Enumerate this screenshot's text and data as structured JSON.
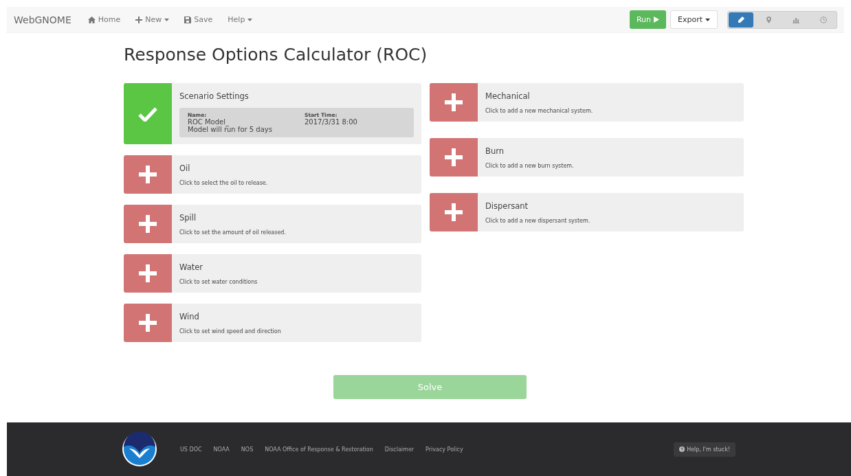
{
  "navbar": {
    "brand": "WebGNOME",
    "items": [
      {
        "label": "Home",
        "dropdown": false
      },
      {
        "label": "New",
        "dropdown": true
      },
      {
        "label": "Save",
        "dropdown": false
      },
      {
        "label": "Help",
        "dropdown": true
      }
    ],
    "run_button": "Run",
    "export_button": "Export",
    "views": [
      {
        "selected": true
      },
      {
        "selected": false
      },
      {
        "selected": false
      },
      {
        "selected": false
      }
    ]
  },
  "title": "Response Options Calculator (ROC)",
  "left_cards": [
    {
      "title": "Scenario Settings",
      "complete": true,
      "details": {
        "name_label": "Name:",
        "name": "ROC Model_",
        "duration": "Model will run for 5 days",
        "start_label": "Start Time:",
        "start": "2017/3/31 8:00"
      }
    },
    {
      "title": "Oil",
      "complete": false,
      "description": "Click to select the oil to release."
    },
    {
      "title": "Spill",
      "complete": false,
      "description": "Click to set the amount of oil released."
    },
    {
      "title": "Water",
      "complete": false,
      "description": "Click to set water conditions"
    },
    {
      "title": "Wind",
      "complete": false,
      "description": "Click to set wind speed and direction"
    }
  ],
  "right_cards": [
    {
      "title": "Mechanical",
      "complete": false,
      "description": "Click to add a new mechanical system."
    },
    {
      "title": "Burn",
      "complete": false,
      "description": "Click to add a new burn system."
    },
    {
      "title": "Dispersant",
      "complete": false,
      "description": "Click to add a new dispersant system."
    }
  ],
  "solve_button": {
    "label": "Solve",
    "disabled": true
  },
  "footer": {
    "links": [
      "US DOC",
      "NOAA",
      "NOS",
      "NOAA Office of Response & Restoration",
      "Disclaimer",
      "Privacy Policy"
    ],
    "help_button": "Help, I'm stuck!"
  }
}
